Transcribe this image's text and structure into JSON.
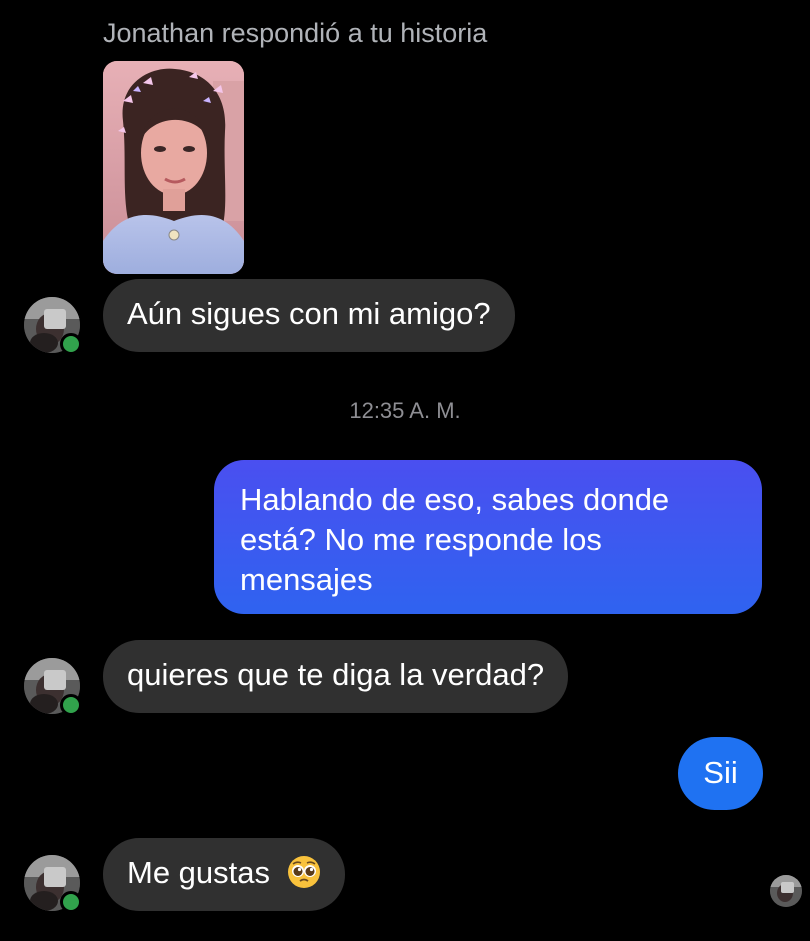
{
  "story_reply": {
    "caption": "Jonathan respondió a tu historia"
  },
  "timestamp": "12:35 A. M.",
  "messages": [
    {
      "direction": "incoming",
      "text": "Aún sigues con mi amigo?"
    },
    {
      "direction": "outgoing",
      "lines": [
        "Hablando de eso, sabes donde",
        "está? No me responde los",
        "mensajes"
      ]
    },
    {
      "direction": "incoming",
      "text": "quieres que te diga la verdad?"
    },
    {
      "direction": "outgoing",
      "text": "Sii"
    },
    {
      "direction": "incoming",
      "text": "Me gustas",
      "emoji": "pleading-face-emoji"
    }
  ],
  "icons": {
    "contact_avatar": "contact-avatar",
    "online_status": "online-indicator",
    "seen_receipt": "seen-avatar"
  },
  "colors": {
    "background": "#000000",
    "incoming_bubble": "#303030",
    "outgoing_gradient_top": "#4a4ff0",
    "outgoing_gradient_bottom": "#1e74f2",
    "caption_text": "#b0b3b8",
    "timestamp_text": "#8e8e93",
    "online": "#31a24c"
  }
}
